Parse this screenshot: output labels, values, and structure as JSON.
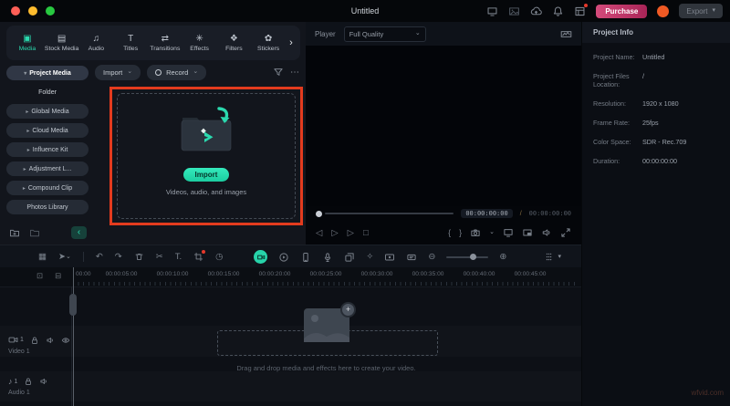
{
  "titlebar": {
    "title": "Untitled",
    "purchase": "Purchase",
    "export": "Export"
  },
  "icons": {
    "media": "▣",
    "stock_media": "▤",
    "audio": "♫",
    "titles": "T",
    "transitions": "⇄",
    "effects": "✳",
    "filters": "❖",
    "stickers": "✿",
    "panel_more": "›",
    "caret_down": "⌄",
    "chevron_down": "▾",
    "chevron_right": "▸",
    "more_dots": "⋯",
    "undo": "↶",
    "redo": "↷",
    "scissors": "✂",
    "text_tool": "T.",
    "speed": "◷",
    "select_cursor": "➤",
    "grid_view": "▦",
    "step_back": "◁",
    "play": "▷",
    "step_forward": "▷",
    "stop": "□",
    "mark_in": "{",
    "mark_out": "}",
    "zoom_out": "⊖",
    "zoom_in": "⊕",
    "keyframe": "✧",
    "note": "♪",
    "collapse": "‹",
    "plus": "+",
    "ruler_tool_1": "⊡",
    "ruler_tool_2": "⊟"
  },
  "media_panel": {
    "tabs": [
      {
        "label": "Media"
      },
      {
        "label": "Stock Media"
      },
      {
        "label": "Audio"
      },
      {
        "label": "Titles"
      },
      {
        "label": "Transitions"
      },
      {
        "label": "Effects"
      },
      {
        "label": "Filters"
      },
      {
        "label": "Stickers"
      }
    ],
    "sidebar": [
      {
        "label": "Project Media"
      },
      {
        "label": "Folder"
      },
      {
        "label": "Global Media"
      },
      {
        "label": "Cloud Media"
      },
      {
        "label": "Influence Kit"
      },
      {
        "label": "Adjustment L..."
      },
      {
        "label": "Compound Clip"
      },
      {
        "label": "Photos Library"
      }
    ],
    "import_button": "Import",
    "record_button": "Record",
    "dropzone": {
      "button": "Import",
      "caption": "Videos, audio, and images"
    }
  },
  "player": {
    "label": "Player",
    "quality": "Full Quality",
    "current_time": "00:00:00:00",
    "separator": "/",
    "total_time": "00:00:00:00"
  },
  "project_info": {
    "title": "Project Info",
    "rows": [
      {
        "label": "Project Name:",
        "value": "Untitled"
      },
      {
        "label": "Project Files Location:",
        "value": "/"
      },
      {
        "label": "Resolution:",
        "value": "1920 x 1080"
      },
      {
        "label": "Frame Rate:",
        "value": "25fps"
      },
      {
        "label": "Color Space:",
        "value": "SDR - Rec.709"
      },
      {
        "label": "Duration:",
        "value": "00:00:00:00"
      }
    ]
  },
  "timeline": {
    "ruler_labels": [
      "00:00",
      "00:00:05:00",
      "00:00:10:00",
      "00:00:15:00",
      "00:00:20:00",
      "00:00:25:00",
      "00:00:30:00",
      "00:00:35:00",
      "00:00:40:00",
      "00:00:45:00"
    ],
    "tracks": [
      {
        "number": "1",
        "name": "Video 1"
      },
      {
        "number": "1",
        "name": "Audio 1"
      }
    ],
    "drop_hint": "Drag and drop media and effects here to create your video."
  },
  "colors": {
    "accent_teal": "#27d3aa",
    "highlight_red": "#e33b1e",
    "purchase_pink": "#c22d62",
    "avatar_orange": "#f05a24"
  },
  "watermark": "wfvid.com"
}
